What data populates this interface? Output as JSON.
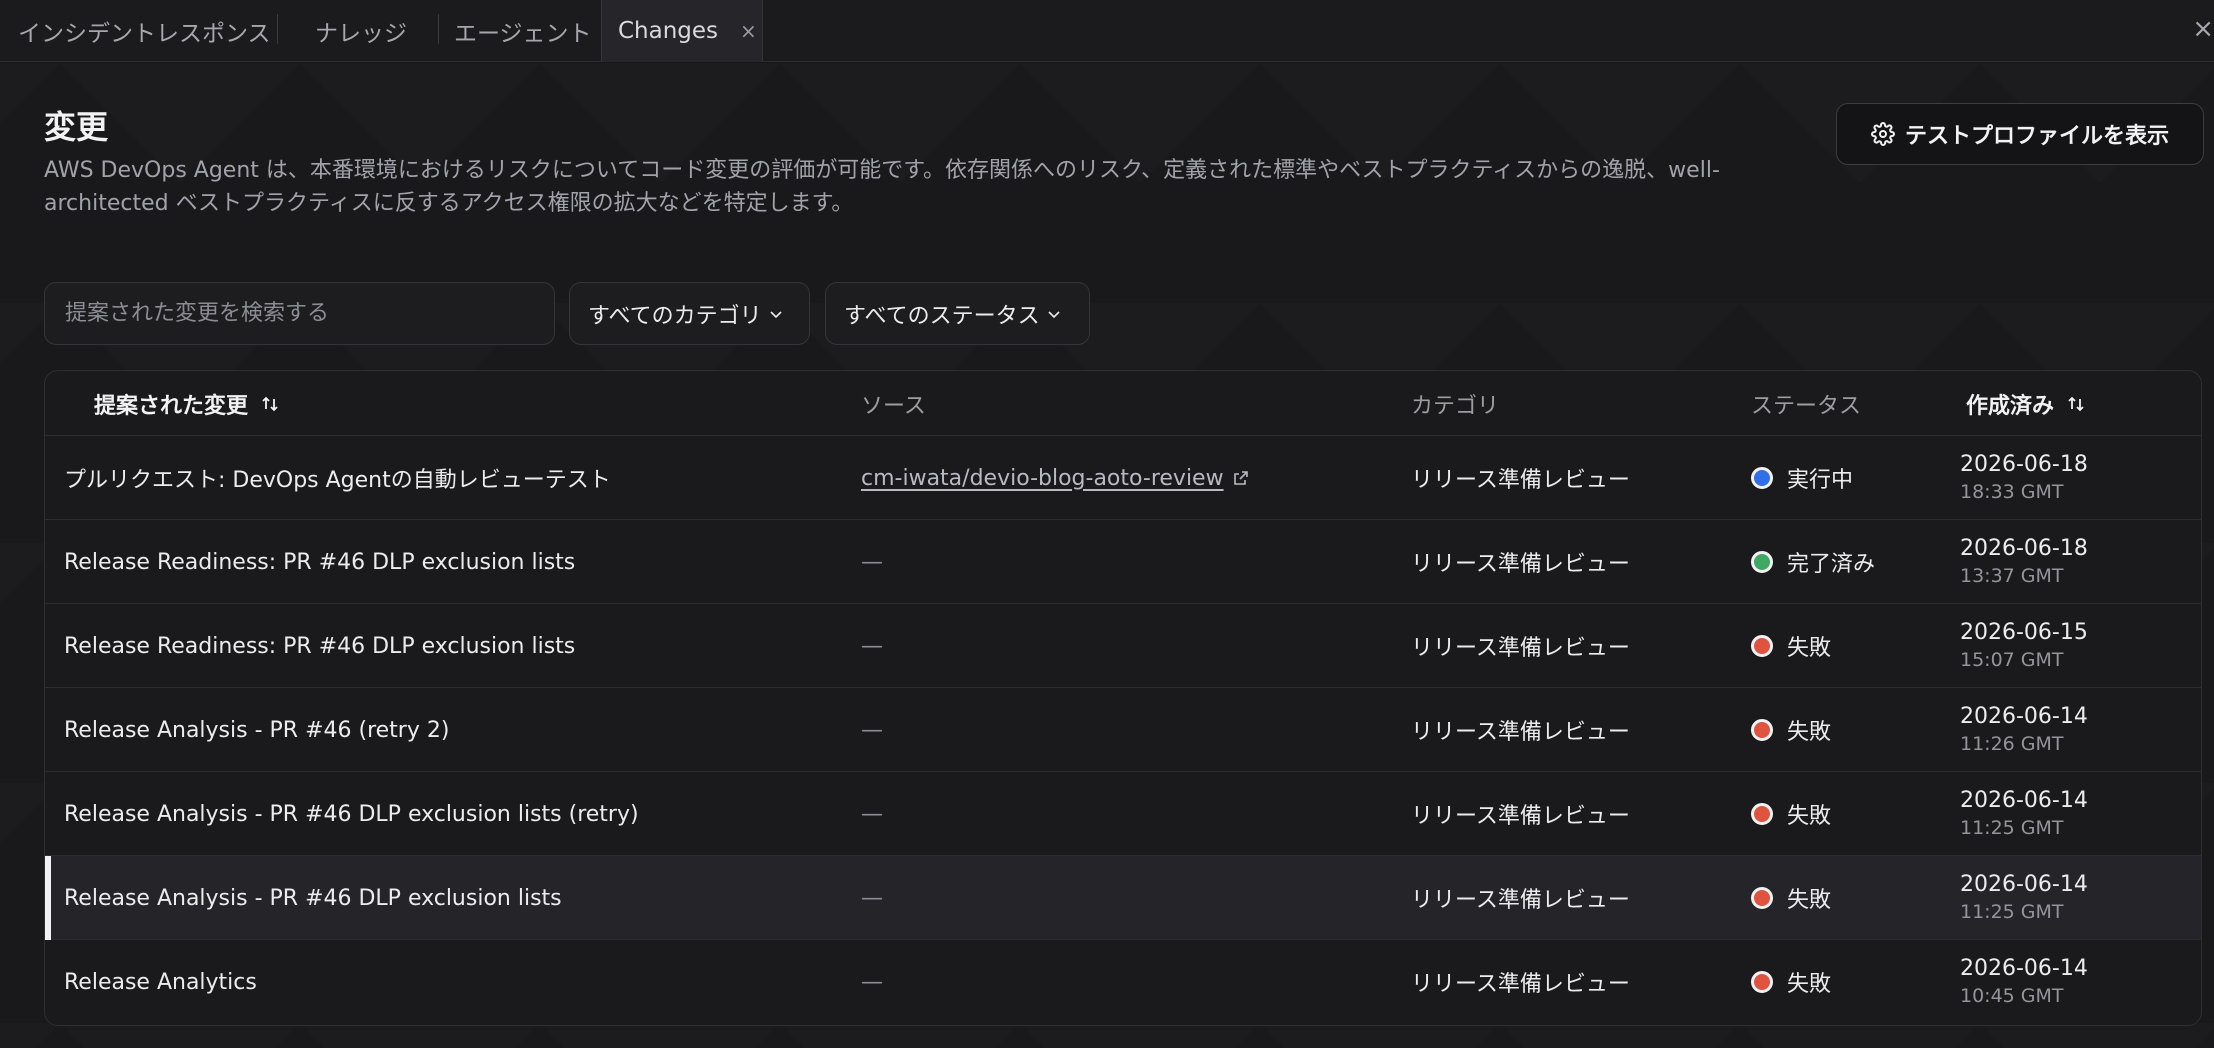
{
  "tabs": [
    {
      "label": "インシデントレスポンス"
    },
    {
      "label": "ナレッジ"
    },
    {
      "label": "エージェント"
    },
    {
      "label": "Changes",
      "close": "×"
    }
  ],
  "window_close": "×",
  "header": {
    "title": "変更",
    "description": "AWS DevOps Agent は、本番環境におけるリスクについてコード変更の評価が可能です。依存関係へのリスク、定義された標準やベストプラクティスからの逸脱、well-architected ベストプラクティスに反するアクセス権限の拡大などを特定します。",
    "profile_button": "テストプロファイルを表示"
  },
  "filters": {
    "search_placeholder": "提案された変更を検索する",
    "category_select": "すべてのカテゴリ",
    "status_select": "すべてのステータス"
  },
  "table": {
    "columns": {
      "proposed": "提案された変更",
      "source": "ソース",
      "category": "カテゴリ",
      "status": "ステータス",
      "created": "作成済み"
    },
    "rows": [
      {
        "title": "プルリクエスト: DevOps Agentの自動レビューテスト",
        "source": "cm-iwata/devio-blog-aoto-review",
        "category": "リリース準備レビュー",
        "status": "実行中",
        "status_color": "#2f6fe8",
        "date": "2026-06-18",
        "time": "18:33 GMT"
      },
      {
        "title": "Release Readiness: PR #46 DLP exclusion lists",
        "source": "—",
        "category": "リリース準備レビュー",
        "status": "完了済み",
        "status_color": "#3fa862",
        "date": "2026-06-18",
        "time": "13:37 GMT"
      },
      {
        "title": "Release Readiness: PR #46 DLP exclusion lists",
        "source": "—",
        "category": "リリース準備レビュー",
        "status": "失敗",
        "status_color": "#e0533f",
        "date": "2026-06-15",
        "time": "15:07 GMT"
      },
      {
        "title": "Release Analysis - PR #46 (retry 2)",
        "source": "—",
        "category": "リリース準備レビュー",
        "status": "失敗",
        "status_color": "#e0533f",
        "date": "2026-06-14",
        "time": "11:26 GMT"
      },
      {
        "title": "Release Analysis - PR #46 DLP exclusion lists (retry)",
        "source": "—",
        "category": "リリース準備レビュー",
        "status": "失敗",
        "status_color": "#e0533f",
        "date": "2026-06-14",
        "time": "11:25 GMT"
      },
      {
        "title": "Release Analysis - PR #46 DLP exclusion lists",
        "source": "—",
        "category": "リリース準備レビュー",
        "status": "失敗",
        "status_color": "#e0533f",
        "date": "2026-06-14",
        "time": "11:25 GMT"
      },
      {
        "title": "Release Analytics",
        "source": "—",
        "category": "リリース準備レビュー",
        "status": "失敗",
        "status_color": "#e0533f",
        "date": "2026-06-14",
        "time": "10:45 GMT"
      }
    ]
  }
}
